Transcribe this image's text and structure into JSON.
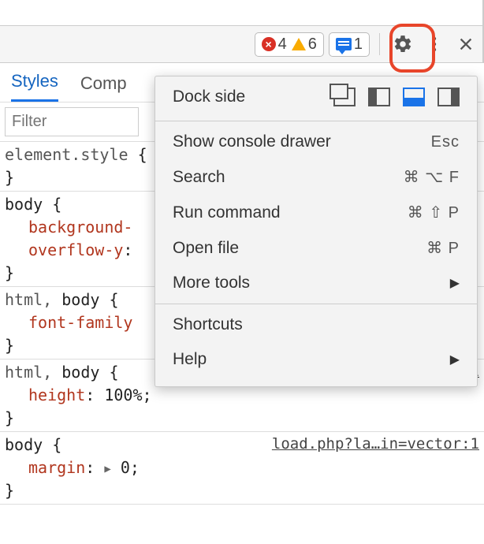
{
  "toolbar": {
    "errors": "4",
    "warnings": "6",
    "messages": "1"
  },
  "tabs": {
    "styles": "Styles",
    "computed": "Comp"
  },
  "filter": {
    "placeholder": "Filter"
  },
  "rules": {
    "r0": {
      "selector": "element.style"
    },
    "r1": {
      "selector_a": "body",
      "p1": "background-",
      "p2": "overflow-y",
      "colon": ":"
    },
    "r2": {
      "selector_a": "html",
      "selector_b": "body",
      "p1": "font-family"
    },
    "r3": {
      "selector_a": "html",
      "selector_b": "body",
      "p1_name": "height",
      "p1_val": "100%;",
      "src": "load.php?la…in=vector:1"
    },
    "r4": {
      "selector_a": "body",
      "p1_name": "margin",
      "p1_val": "0;",
      "src": "load.php?la…in=vector:1"
    }
  },
  "menu": {
    "dock_label": "Dock side",
    "show_console": "Show console drawer",
    "show_console_sc": "Esc",
    "search": "Search",
    "search_sc": "⌘ ⌥ F",
    "run_cmd": "Run command",
    "run_cmd_sc": "⌘ ⇧ P",
    "open_file": "Open file",
    "open_file_sc": "⌘ P",
    "more_tools": "More tools",
    "shortcuts": "Shortcuts",
    "help": "Help"
  }
}
